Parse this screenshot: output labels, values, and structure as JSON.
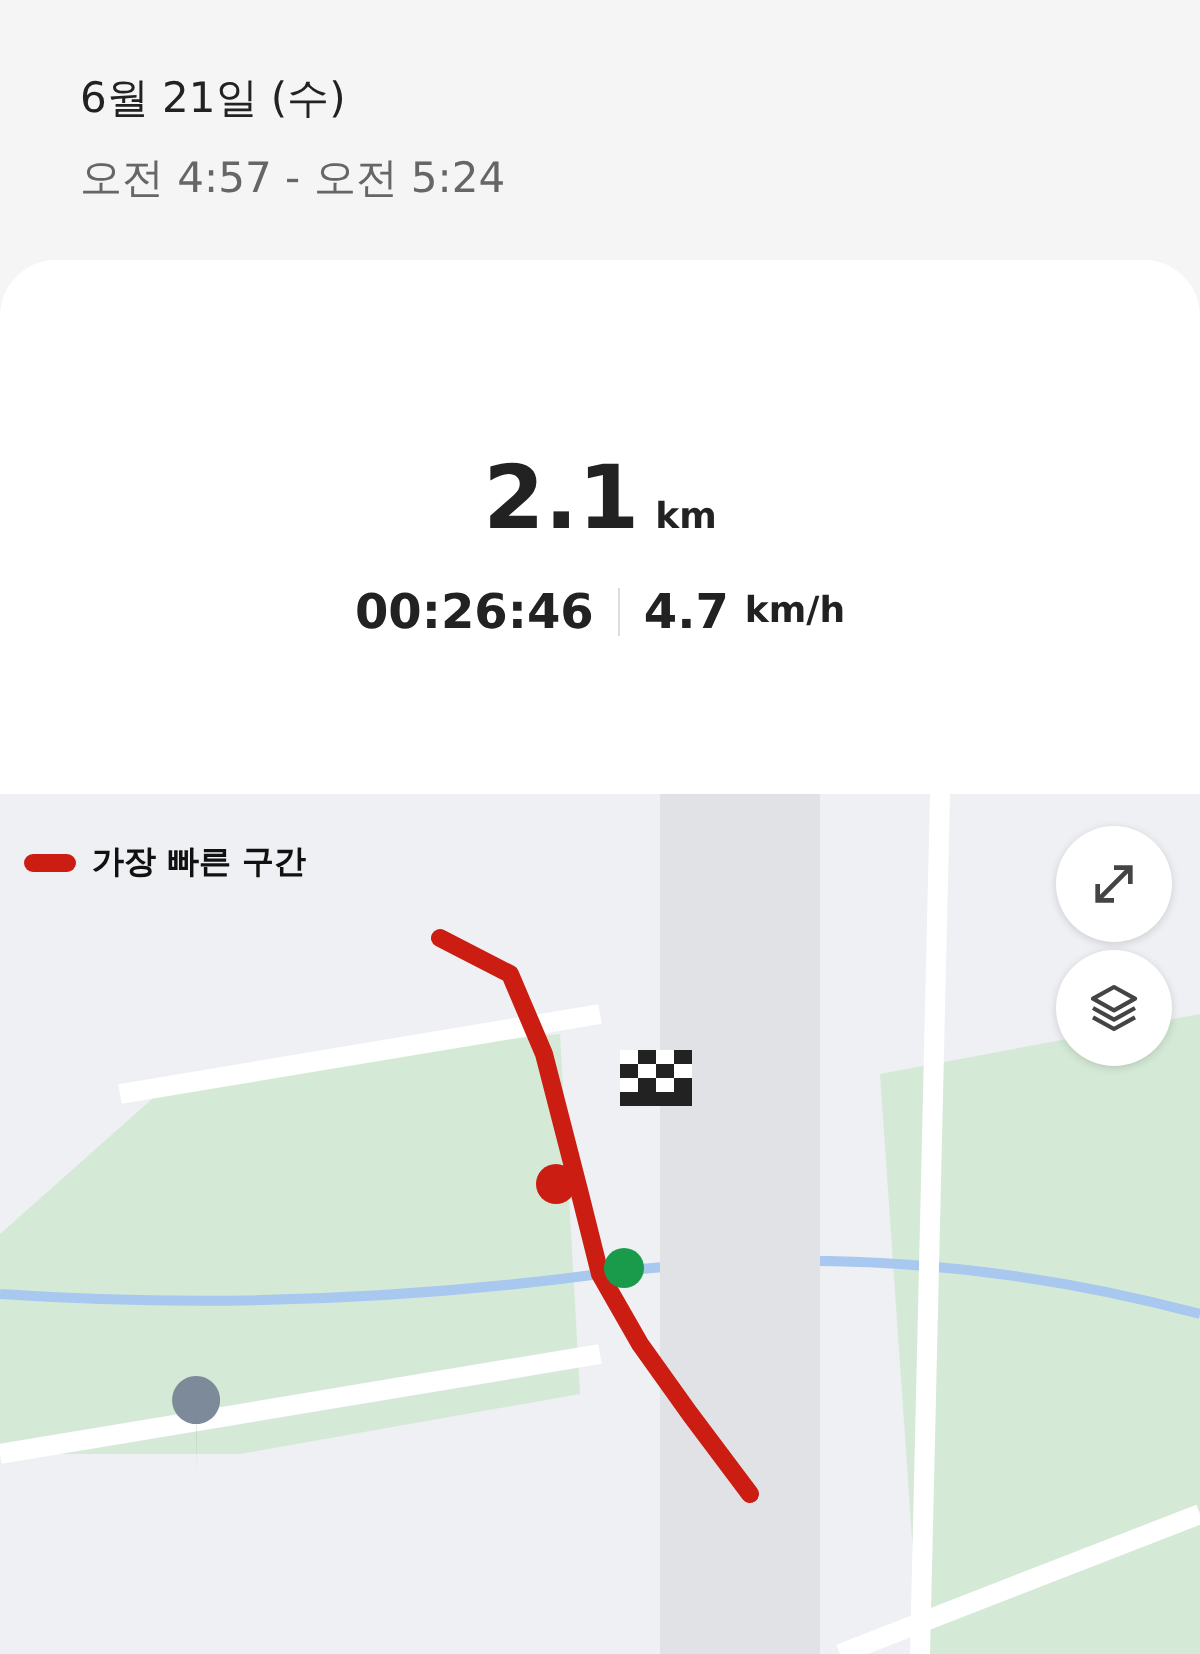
{
  "header": {
    "date": "6월 21일 (수)",
    "time_range": "오전 4:57 - 오전 5:24"
  },
  "summary": {
    "distance": "2.1",
    "distance_unit": "km",
    "duration": "00:26:46",
    "speed": "4.7",
    "speed_unit": "km/h"
  },
  "map": {
    "kind": "picture",
    "legend": {
      "label": "가장 빠른 구간",
      "color": "#cc1d12"
    },
    "controls": [
      {
        "kind": "expand"
      },
      {
        "kind": "layers"
      }
    ]
  }
}
